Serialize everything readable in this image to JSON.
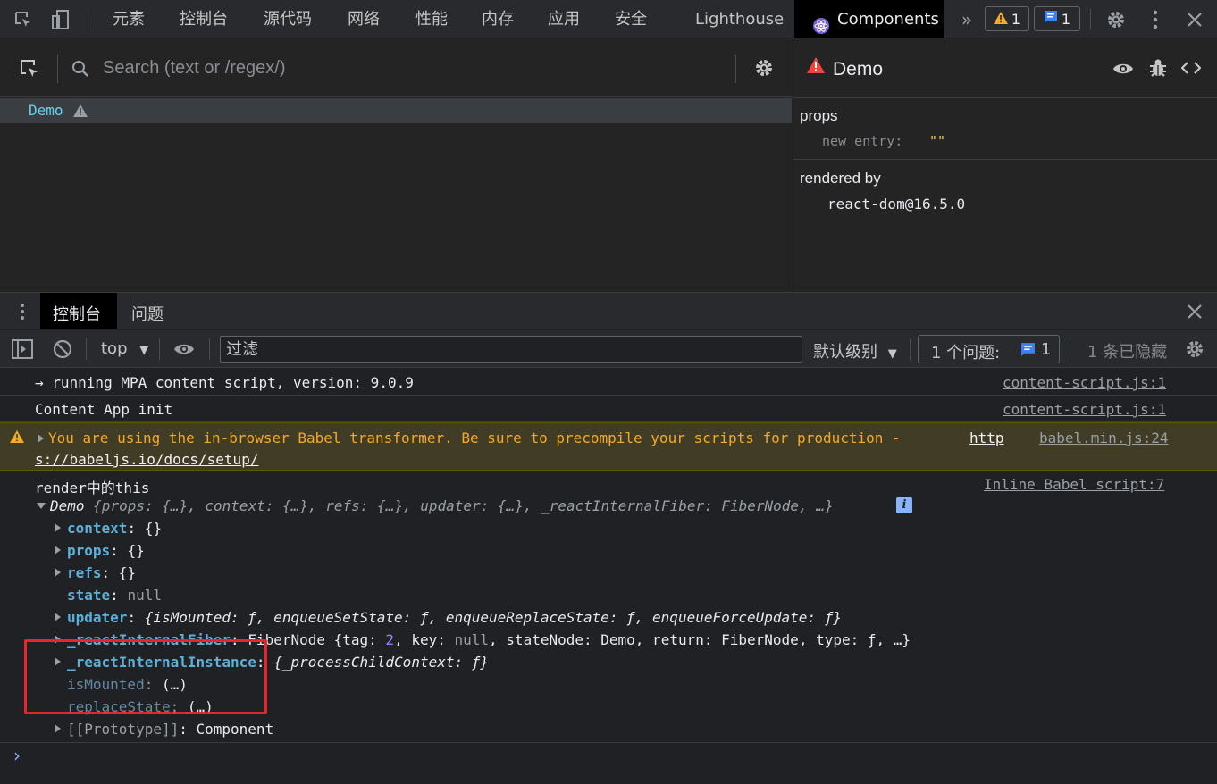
{
  "topbar": {
    "tabs": [
      "元素",
      "控制台",
      "源代码",
      "网络",
      "性能",
      "内存",
      "应用",
      "安全",
      "Lighthouse"
    ],
    "active_tab": "Components",
    "warning_count": "1",
    "info_count": "1"
  },
  "components": {
    "search_placeholder": "Search (text or /regex/)",
    "tree_items": [
      {
        "label": "Demo"
      }
    ],
    "inspector": {
      "title": "Demo",
      "props_heading": "props",
      "prop_key": "new entry",
      "prop_value": "\"\"",
      "rendered_by_heading": "rendered by",
      "renderer": "react-dom@16.5.0"
    }
  },
  "drawer": {
    "tabs": [
      "控制台",
      "问题"
    ],
    "active_tab": "控制台"
  },
  "console_toolbar": {
    "context": "top",
    "filter_placeholder": "过滤",
    "level": "默认级别",
    "issues_label": "1 个问题:",
    "issues_count": "1",
    "hidden_label": "1 条已隐藏"
  },
  "console": {
    "messages": [
      {
        "text": "→ running MPA content script, version: 9.0.9",
        "source": "content-script.js:1"
      },
      {
        "text": "Content App init",
        "source": "content-script.js:1"
      },
      {
        "text_line1": "You are using the in-browser Babel transformer. Be sure to precompile your scripts for production - ",
        "link1": "http",
        "link2": "s://babeljs.io/docs/setup/",
        "source": "babel.min.js:24",
        "level": "warning"
      },
      {
        "text": "render中的this",
        "source": "Inline Babel script:7"
      }
    ],
    "object": {
      "summary_name": "Demo",
      "summary_props": "{props: {…}, context: {…}, refs: {…}, updater: {…}, _reactInternalFiber: FiberNode, …}",
      "rows": [
        {
          "key": "context",
          "sep": ": ",
          "value": "{}"
        },
        {
          "key": "props",
          "sep": ": ",
          "value": "{}"
        },
        {
          "key": "refs",
          "sep": ": ",
          "value": "{}"
        },
        {
          "key": "state",
          "sep": ": ",
          "value": "null"
        },
        {
          "key": "updater",
          "sep": ": ",
          "value": "{isMounted: ƒ, enqueueSetState: ƒ, enqueueReplaceState: ƒ, enqueueForceUpdate: ƒ}"
        },
        {
          "key": "_reactInternalFiber",
          "sep": ": ",
          "value_pre": "FiberNode {tag: ",
          "value_num": "2",
          "value_mid": ", key: ",
          "value_null": "null",
          "value_post": ", stateNode: Demo, return: FiberNode, type: ƒ, …}"
        },
        {
          "key": "_reactInternalInstance",
          "sep": ": ",
          "value": "{_processChildContext: ƒ}"
        },
        {
          "key": "isMounted",
          "sep": ":  ",
          "value": "(…)"
        },
        {
          "key": "replaceState",
          "sep": ":  ",
          "value": "(…)"
        },
        {
          "key": "[[Prototype]]",
          "sep": ": ",
          "value": "Component"
        }
      ]
    },
    "prompt": "›"
  },
  "colors": {
    "highlight_box": "#e8252d",
    "warning_bg": "#413c26",
    "warning_text": "#f2ab26",
    "accent_blue": "#8ab4f8"
  }
}
